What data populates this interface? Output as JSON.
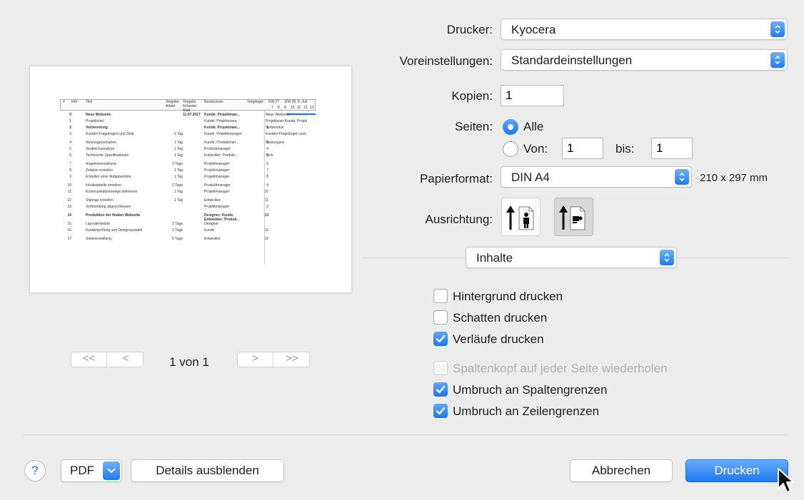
{
  "printer": {
    "label": "Drucker:",
    "value": "Kyocera"
  },
  "presets": {
    "label": "Voreinstellungen:",
    "value": "Standardeinstellungen"
  },
  "copies": {
    "label": "Kopien:",
    "value": "1"
  },
  "pages": {
    "label": "Seiten:",
    "all_label": "Alle",
    "from_label": "Von:",
    "from_value": "1",
    "to_label": "bis:",
    "to_value": "1",
    "selected": "all"
  },
  "paper": {
    "label": "Papierformat:",
    "value": "DIN A4",
    "size": "210 x 297 mm"
  },
  "orientation": {
    "label": "Ausrichtung:",
    "selected": "landscape"
  },
  "section": {
    "value": "Inhalte"
  },
  "options": [
    {
      "label": "Hintergrund drucken",
      "checked": false,
      "enabled": true
    },
    {
      "label": "Schatten drucken",
      "checked": false,
      "enabled": true
    },
    {
      "label": "Verläufe drucken",
      "checked": true,
      "enabled": true
    },
    {
      "label": "Spaltenkopf auf jeder Seite wiederholen",
      "checked": false,
      "enabled": false
    },
    {
      "label": "Umbruch an Spaltengrenzen",
      "checked": true,
      "enabled": true
    },
    {
      "label": "Umbruch an Zeilengrenzen",
      "checked": true,
      "enabled": true
    }
  ],
  "pager": {
    "text": "1 von 1",
    "first": "<<",
    "prev": "<",
    "next": ">",
    "last": ">>"
  },
  "footer": {
    "help": "?",
    "pdf": "PDF",
    "details": "Details ausblenden",
    "cancel": "Abbrechen",
    "print": "Drucken"
  },
  "colors": {
    "accent": "#1b75f0",
    "window_bg": "#ececec"
  },
  "preview": {
    "headers": [
      "#",
      "Info",
      "Titel",
      "Vorgabe Arbeit",
      "Vorgabe frühester Start",
      "Ressourcen",
      "Vorgänger",
      "KW 27",
      "KW 28, 9. Juli"
    ],
    "day_labels": [
      "7",
      "8",
      "9",
      "10",
      "11",
      "12",
      "13"
    ],
    "rows": [
      {
        "n": "0",
        "title": "Neue Webseite",
        "work": "",
        "start": "11.07.2017",
        "res": "Kunde; Projektman...",
        "pred": "",
        "bold": true,
        "gantt": "Neue Webseite"
      },
      {
        "n": "1",
        "title": "Projektstart",
        "work": "",
        "start": "",
        "res": "Kunde; Projektmana...",
        "pred": "",
        "bold": false,
        "gantt": "Projektstart  Kunde; Projek"
      },
      {
        "n": "2",
        "title": "Vorbereitung",
        "work": "",
        "start": "",
        "res": "Kunde; Projektman...",
        "pred": "1",
        "bold": true,
        "gantt": "Vorbereitun"
      },
      {
        "n": "3",
        "title": "Kunden-Fragebogen und Ziele",
        "work": "1 Tag",
        "start": "",
        "res": "Kunde; Projektmanager",
        "pred": "",
        "bold": false,
        "gantt": "Kunden-Fragebogen und..."
      },
      {
        "n": "4",
        "title": "Nutzungsszenarien",
        "work": "1 Tag",
        "start": "",
        "res": "Kunde; Produktman...",
        "pred": "3",
        "bold": false,
        "gantt": "Nutzungssz"
      },
      {
        "n": "5",
        "title": "Vergleichsanalyse",
        "work": "1 Tag",
        "start": "",
        "res": "Produktmanager",
        "pred": "4",
        "bold": false,
        "gantt": ""
      },
      {
        "n": "6",
        "title": "Technische Spezifikationen",
        "work": "1 Tag",
        "start": "",
        "res": "Entwickler; Produkt...",
        "pred": "5",
        "bold": false,
        "gantt": "Tech"
      },
      {
        "n": "7",
        "title": "Angebotserstellung",
        "work": "2 Tage",
        "start": "",
        "res": "Projektmanager",
        "pred": "6",
        "bold": false,
        "gantt": ""
      },
      {
        "n": "8",
        "title": "Zeitplan erstellen",
        "work": "1 Tag",
        "start": "",
        "res": "Projektmanager",
        "pred": "7",
        "bold": false,
        "gantt": ""
      },
      {
        "n": "9",
        "title": "Erstellen einer Aufgabenliste",
        "work": "1 Tag",
        "start": "",
        "res": "Projektmanager",
        "pred": "8",
        "bold": false,
        "gantt": ""
      },
      {
        "n": "10",
        "title": "Inhaltstabelle erstellen",
        "work": "2 Tage",
        "start": "",
        "res": "Produktmanager",
        "pred": "9",
        "bold": false,
        "gantt": ""
      },
      {
        "n": "11",
        "title": "Kommunikationswege definieren",
        "work": "1 Tag",
        "start": "",
        "res": "Projektmanager",
        "pred": "10",
        "bold": false,
        "gantt": ""
      },
      {
        "n": "12",
        "title": "Sitemap erstellen",
        "work": "1 Tag",
        "start": "",
        "res": "Entwickler",
        "pred": "11",
        "bold": false,
        "gantt": ""
      },
      {
        "n": "13",
        "title": "Vorbereitung abgeschlossen",
        "work": "",
        "start": "",
        "res": "Projektmanager",
        "pred": "2",
        "bold": false,
        "gantt": ""
      },
      {
        "n": "14",
        "title": "Produktion der finalen Webseite",
        "work": "",
        "start": "",
        "res": "Designer; Kunde; Entwickler; Produk...",
        "pred": "13",
        "bold": true,
        "gantt": ""
      },
      {
        "n": "15",
        "title": "Layoutentwürfe",
        "work": "2 Tage",
        "start": "",
        "res": "Designer",
        "pred": "",
        "bold": false,
        "gantt": ""
      },
      {
        "n": "16",
        "title": "Kundenprüfung und Designauswahl",
        "work": "2 Tage",
        "start": "",
        "res": "Kunde",
        "pred": "15",
        "bold": false,
        "gantt": ""
      },
      {
        "n": "17",
        "title": "Seitenerstellung",
        "work": "5 Tage",
        "start": "",
        "res": "Entwickler",
        "pred": "16",
        "bold": false,
        "gantt": ""
      }
    ]
  }
}
